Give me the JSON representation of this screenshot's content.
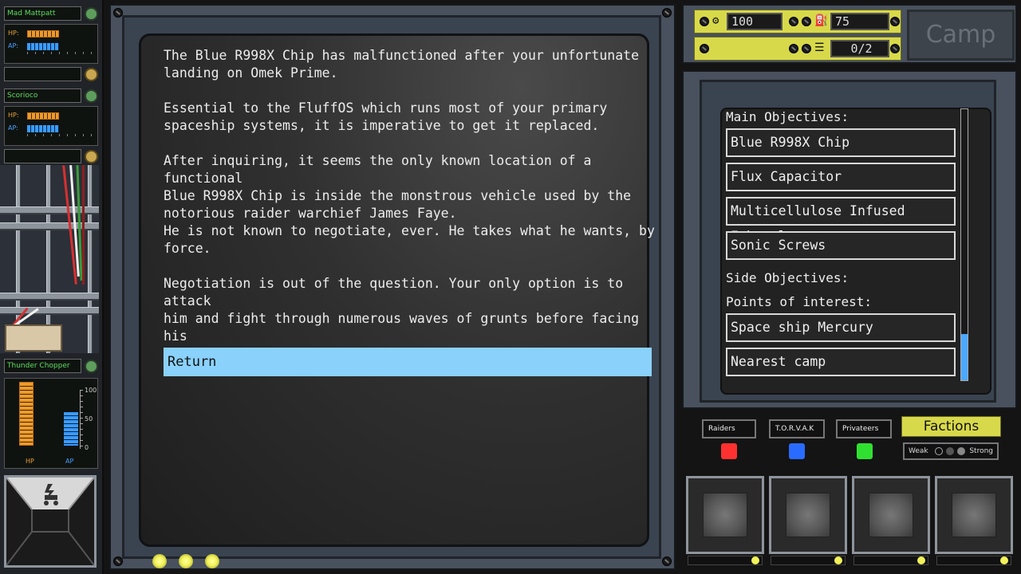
{
  "party": [
    {
      "name": "Mad Mattpatt",
      "hp_label": "HP:",
      "ap_label": "AP:",
      "hp_fraction": 0.95,
      "ap_fraction": 0.9
    },
    {
      "name": "Scorioco",
      "hp_label": "HP:",
      "ap_label": "AP:",
      "hp_fraction": 0.95,
      "ap_fraction": 0.9
    }
  ],
  "vehicle": {
    "name": "Thunder Chopper",
    "scale": [
      "100",
      "50",
      "0"
    ],
    "hp_label": "HP",
    "ap_label": "AP",
    "hp_fraction": 0.95,
    "ap_fraction": 0.5
  },
  "story": {
    "paragraphs": [
      "The Blue R998X Chip has malfunctioned after your unfortunate\nlanding on Omek Prime.",
      "Essential to the FluffOS which runs most of your primary\nspaceship systems, it is imperative to get it replaced.",
      "After inquiring, it seems the only known location of a functional\nBlue R998X Chip is inside the monstrous vehicle used by the\nnotorious raider warchief James Faye.",
      "He is not known to negotiate, ever. He takes what he wants, by\nforce.",
      "Negotiation is out of the question. Your only option is to attack\nhim and fight through numerous waves of grunts before facing his\nmassive engine of destruction."
    ],
    "return_label": "Return"
  },
  "resources": {
    "scrap": "100",
    "fuel": "75",
    "cargo": "0/2"
  },
  "camp_label": "Camp",
  "objectives": {
    "main_heading": "Main Objectives:",
    "main": [
      "Blue R998X Chip",
      "Flux Capacitor",
      "Multicellulose Infused Ethanol",
      "Sonic Screws"
    ],
    "side_heading": "Side Objectives:",
    "poi_heading": "Points of interest:",
    "poi": [
      "Space ship Mercury",
      "Nearest camp"
    ]
  },
  "factions": {
    "label": "Factions",
    "items": [
      {
        "name": "Raiders",
        "color": "#ff3030"
      },
      {
        "name": "T.O.R.V.A.K",
        "color": "#2a6bff"
      },
      {
        "name": "Privateers",
        "color": "#30e030"
      }
    ],
    "weak_label": "Weak",
    "strong_label": "Strong"
  },
  "colors": {
    "return_highlight": "#8ad1fb",
    "accent_yellow": "#d8d94a",
    "hp_orange": "#f09a2a",
    "ap_blue": "#3a9cff"
  }
}
